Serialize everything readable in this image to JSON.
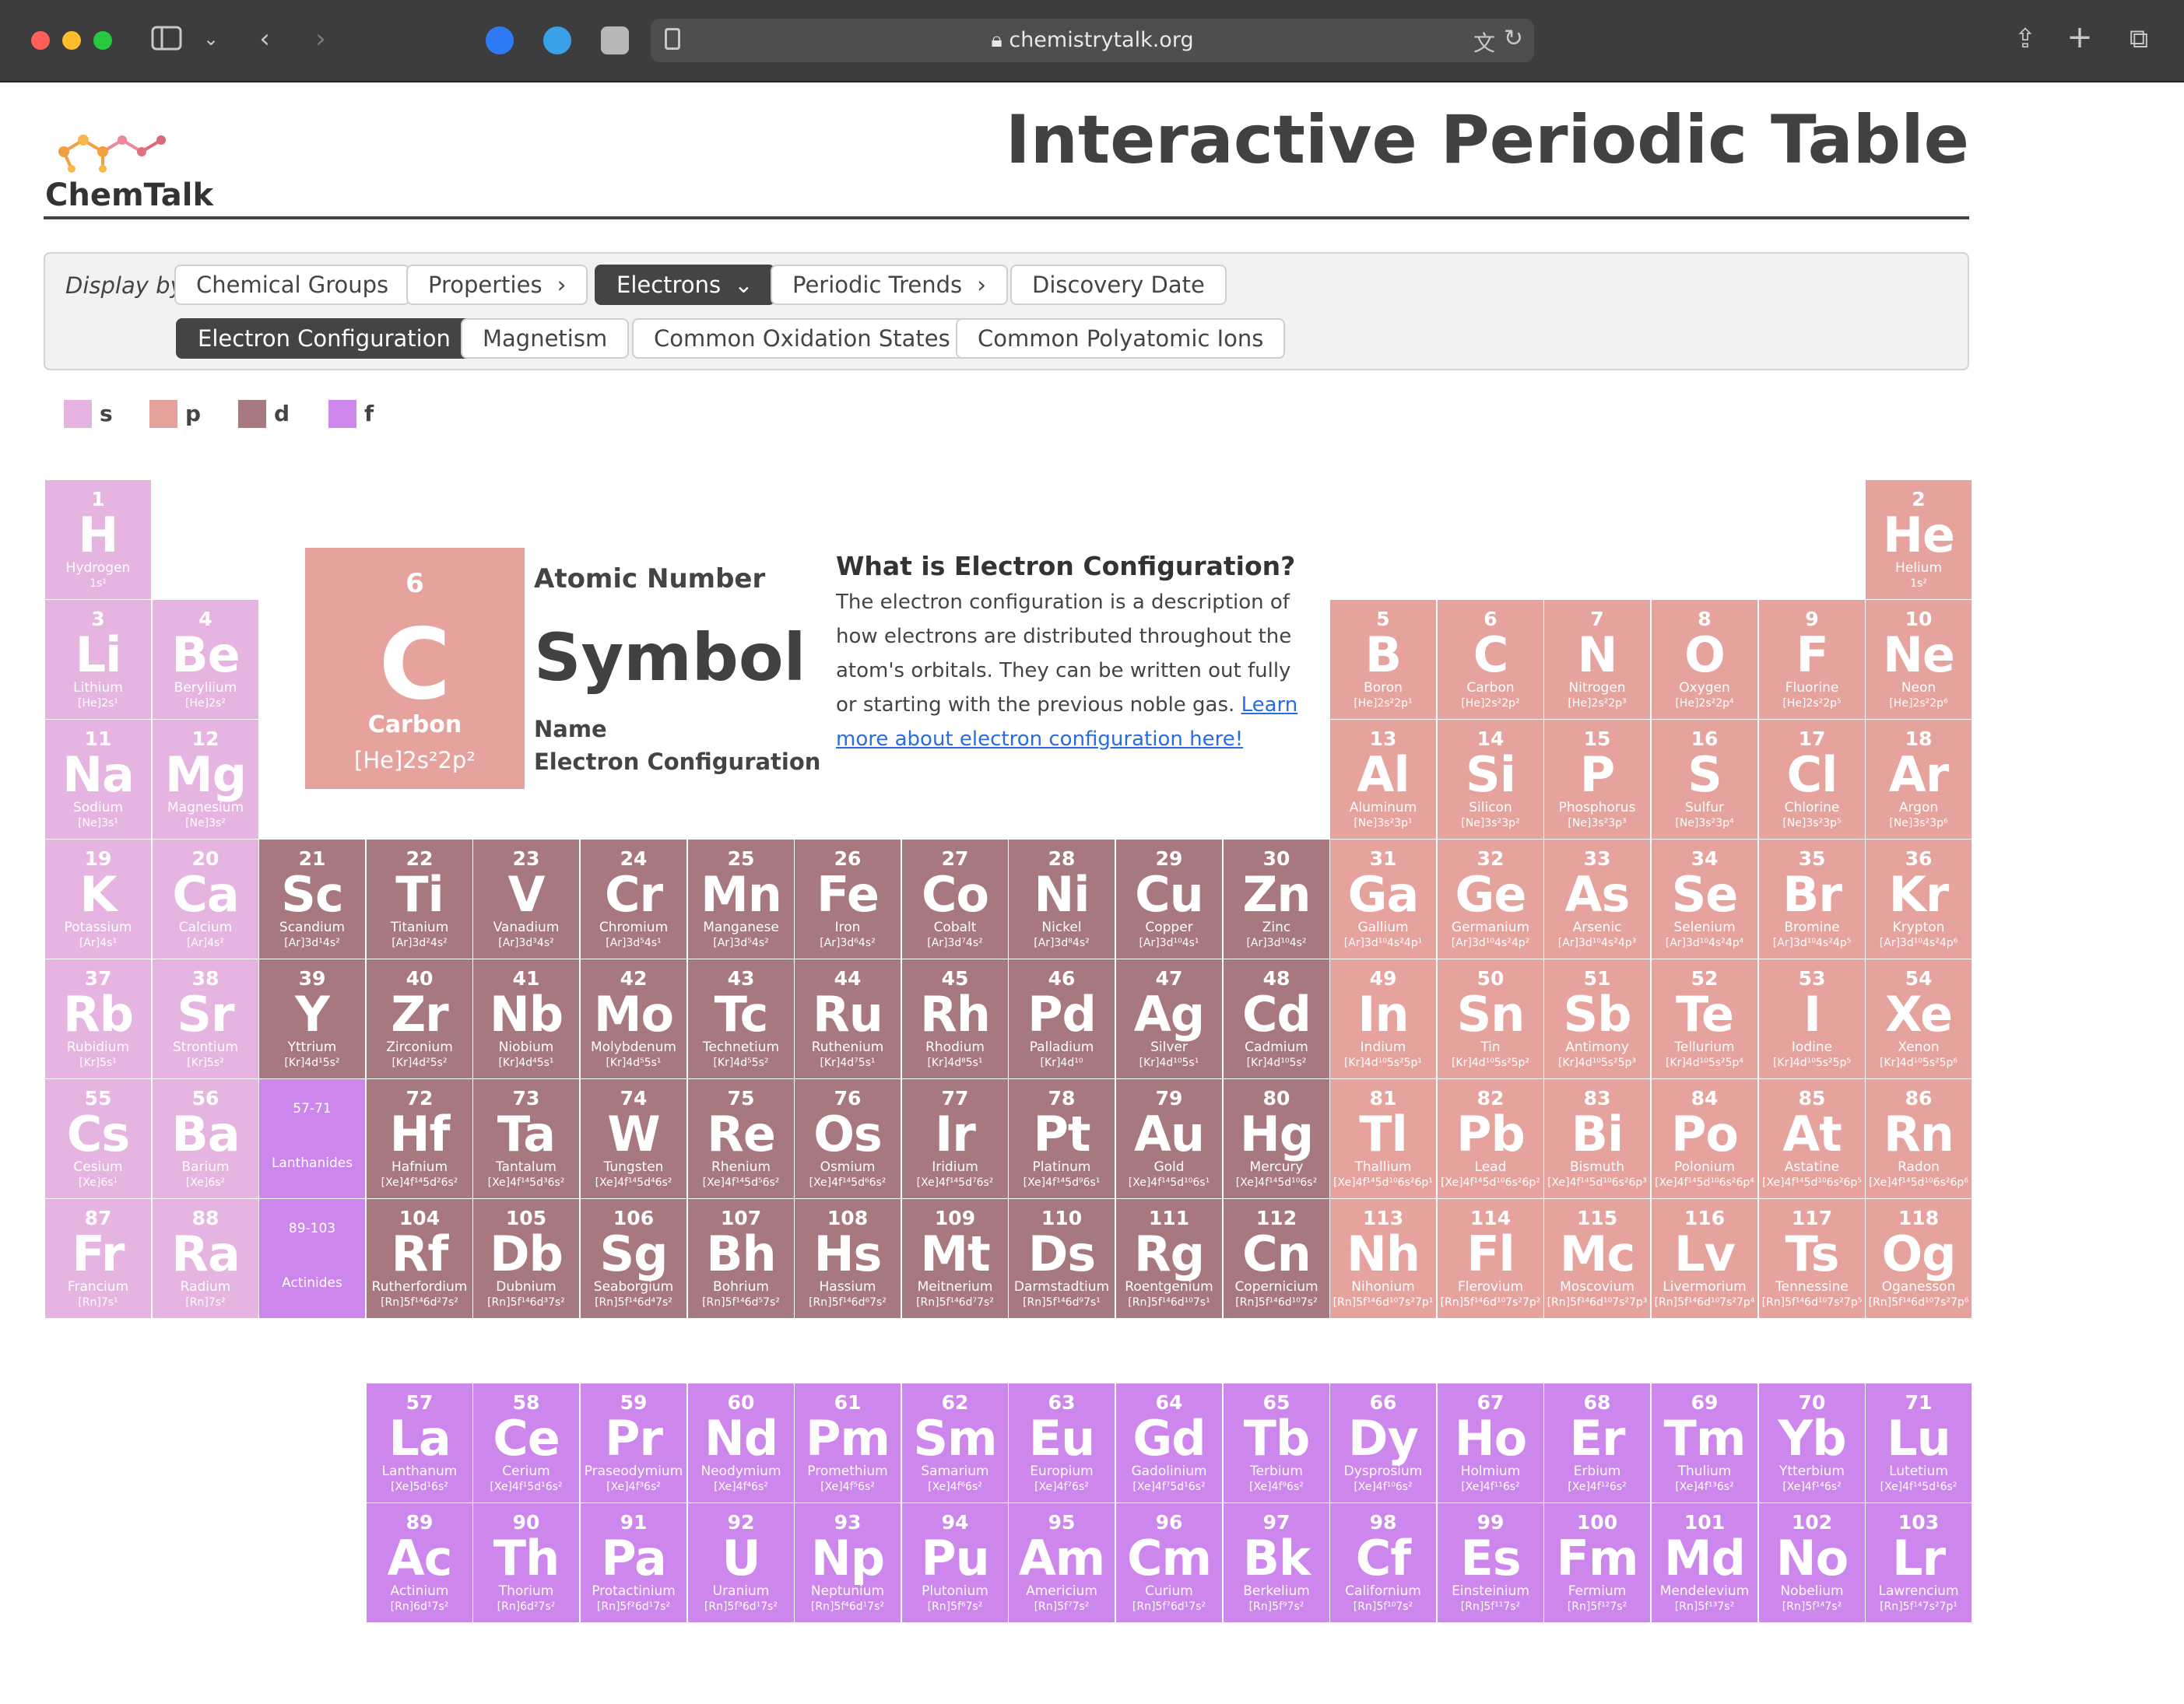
{
  "browser": {
    "url": "chemistrytalk.org"
  },
  "header": {
    "logo_text": "ChemTalk",
    "title": "Interactive Periodic Table"
  },
  "controls": {
    "display_by": "Display by",
    "row1": [
      {
        "label": "Chemical Groups",
        "suffix": ""
      },
      {
        "label": "Properties",
        "suffix": "›"
      },
      {
        "label": "Electrons",
        "suffix": "⌄",
        "active": true
      },
      {
        "label": "Periodic Trends",
        "suffix": "›"
      },
      {
        "label": "Discovery Date",
        "suffix": ""
      }
    ],
    "row2": [
      {
        "label": "Electron Configuration",
        "active": true
      },
      {
        "label": "Magnetism"
      },
      {
        "label": "Common Oxidation States"
      },
      {
        "label": "Common Polyatomic Ions"
      }
    ]
  },
  "legend": [
    {
      "label": "s",
      "color": "#e6b4e0"
    },
    {
      "label": "p",
      "color": "#e6a29d"
    },
    {
      "label": "d",
      "color": "#a8787f"
    },
    {
      "label": "f",
      "color": "#cc86ec"
    }
  ],
  "key": {
    "number": "6",
    "symbol": "C",
    "name": "Carbon",
    "config": "[He]2s²2p²",
    "labels": {
      "number": "Atomic Number",
      "symbol": "Symbol",
      "name": "Name",
      "config": "Electron Configuration"
    }
  },
  "info": {
    "heading": "What is Electron Configuration?",
    "body": "The electron configuration is a description of how electrons are distributed throughout the atom's orbitals. They can be written out fully or starting with the previous noble gas. ",
    "link": "Learn more about electron configuration here!"
  },
  "placeholders": [
    {
      "range": "57-71",
      "name": "Lanthanides"
    },
    {
      "range": "89-103",
      "name": "Actinides"
    }
  ],
  "elements": [
    [
      "1",
      "H",
      "Hydrogen",
      "1s¹",
      "s"
    ],
    [
      "2",
      "He",
      "Helium",
      "1s²",
      "p"
    ],
    [
      "3",
      "Li",
      "Lithium",
      "[He]2s¹",
      "s"
    ],
    [
      "4",
      "Be",
      "Beryllium",
      "[He]2s²",
      "s"
    ],
    [
      "5",
      "B",
      "Boron",
      "[He]2s²2p¹",
      "p"
    ],
    [
      "6",
      "C",
      "Carbon",
      "[He]2s²2p²",
      "p"
    ],
    [
      "7",
      "N",
      "Nitrogen",
      "[He]2s²2p³",
      "p"
    ],
    [
      "8",
      "O",
      "Oxygen",
      "[He]2s²2p⁴",
      "p"
    ],
    [
      "9",
      "F",
      "Fluorine",
      "[He]2s²2p⁵",
      "p"
    ],
    [
      "10",
      "Ne",
      "Neon",
      "[He]2s²2p⁶",
      "p"
    ],
    [
      "11",
      "Na",
      "Sodium",
      "[Ne]3s¹",
      "s"
    ],
    [
      "12",
      "Mg",
      "Magnesium",
      "[Ne]3s²",
      "s"
    ],
    [
      "13",
      "Al",
      "Aluminum",
      "[Ne]3s²3p¹",
      "p"
    ],
    [
      "14",
      "Si",
      "Silicon",
      "[Ne]3s²3p²",
      "p"
    ],
    [
      "15",
      "P",
      "Phosphorus",
      "[Ne]3s²3p³",
      "p"
    ],
    [
      "16",
      "S",
      "Sulfur",
      "[Ne]3s²3p⁴",
      "p"
    ],
    [
      "17",
      "Cl",
      "Chlorine",
      "[Ne]3s²3p⁵",
      "p"
    ],
    [
      "18",
      "Ar",
      "Argon",
      "[Ne]3s²3p⁶",
      "p"
    ],
    [
      "19",
      "K",
      "Potassium",
      "[Ar]4s¹",
      "s"
    ],
    [
      "20",
      "Ca",
      "Calcium",
      "[Ar]4s²",
      "s"
    ],
    [
      "21",
      "Sc",
      "Scandium",
      "[Ar]3d¹4s²",
      "d"
    ],
    [
      "22",
      "Ti",
      "Titanium",
      "[Ar]3d²4s²",
      "d"
    ],
    [
      "23",
      "V",
      "Vanadium",
      "[Ar]3d³4s²",
      "d"
    ],
    [
      "24",
      "Cr",
      "Chromium",
      "[Ar]3d⁵4s¹",
      "d"
    ],
    [
      "25",
      "Mn",
      "Manganese",
      "[Ar]3d⁵4s²",
      "d"
    ],
    [
      "26",
      "Fe",
      "Iron",
      "[Ar]3d⁶4s²",
      "d"
    ],
    [
      "27",
      "Co",
      "Cobalt",
      "[Ar]3d⁷4s²",
      "d"
    ],
    [
      "28",
      "Ni",
      "Nickel",
      "[Ar]3d⁸4s²",
      "d"
    ],
    [
      "29",
      "Cu",
      "Copper",
      "[Ar]3d¹⁰4s¹",
      "d"
    ],
    [
      "30",
      "Zn",
      "Zinc",
      "[Ar]3d¹⁰4s²",
      "d"
    ],
    [
      "31",
      "Ga",
      "Gallium",
      "[Ar]3d¹⁰4s²4p¹",
      "p"
    ],
    [
      "32",
      "Ge",
      "Germanium",
      "[Ar]3d¹⁰4s²4p²",
      "p"
    ],
    [
      "33",
      "As",
      "Arsenic",
      "[Ar]3d¹⁰4s²4p³",
      "p"
    ],
    [
      "34",
      "Se",
      "Selenium",
      "[Ar]3d¹⁰4s²4p⁴",
      "p"
    ],
    [
      "35",
      "Br",
      "Bromine",
      "[Ar]3d¹⁰4s²4p⁵",
      "p"
    ],
    [
      "36",
      "Kr",
      "Krypton",
      "[Ar]3d¹⁰4s²4p⁶",
      "p"
    ],
    [
      "37",
      "Rb",
      "Rubidium",
      "[Kr]5s¹",
      "s"
    ],
    [
      "38",
      "Sr",
      "Strontium",
      "[Kr]5s²",
      "s"
    ],
    [
      "39",
      "Y",
      "Yttrium",
      "[Kr]4d¹5s²",
      "d"
    ],
    [
      "40",
      "Zr",
      "Zirconium",
      "[Kr]4d²5s²",
      "d"
    ],
    [
      "41",
      "Nb",
      "Niobium",
      "[Kr]4d⁴5s¹",
      "d"
    ],
    [
      "42",
      "Mo",
      "Molybdenum",
      "[Kr]4d⁵5s¹",
      "d"
    ],
    [
      "43",
      "Tc",
      "Technetium",
      "[Kr]4d⁵5s²",
      "d"
    ],
    [
      "44",
      "Ru",
      "Ruthenium",
      "[Kr]4d⁷5s¹",
      "d"
    ],
    [
      "45",
      "Rh",
      "Rhodium",
      "[Kr]4d⁸5s¹",
      "d"
    ],
    [
      "46",
      "Pd",
      "Palladium",
      "[Kr]4d¹⁰",
      "d"
    ],
    [
      "47",
      "Ag",
      "Silver",
      "[Kr]4d¹⁰5s¹",
      "d"
    ],
    [
      "48",
      "Cd",
      "Cadmium",
      "[Kr]4d¹⁰5s²",
      "d"
    ],
    [
      "49",
      "In",
      "Indium",
      "[Kr]4d¹⁰5s²5p¹",
      "p"
    ],
    [
      "50",
      "Sn",
      "Tin",
      "[Kr]4d¹⁰5s²5p²",
      "p"
    ],
    [
      "51",
      "Sb",
      "Antimony",
      "[Kr]4d¹⁰5s²5p³",
      "p"
    ],
    [
      "52",
      "Te",
      "Tellurium",
      "[Kr]4d¹⁰5s²5p⁴",
      "p"
    ],
    [
      "53",
      "I",
      "Iodine",
      "[Kr]4d¹⁰5s²5p⁵",
      "p"
    ],
    [
      "54",
      "Xe",
      "Xenon",
      "[Kr]4d¹⁰5s²5p⁶",
      "p"
    ],
    [
      "55",
      "Cs",
      "Cesium",
      "[Xe]6s¹",
      "s"
    ],
    [
      "56",
      "Ba",
      "Barium",
      "[Xe]6s²",
      "s"
    ],
    [
      "72",
      "Hf",
      "Hafnium",
      "[Xe]4f¹⁴5d²6s²",
      "d"
    ],
    [
      "73",
      "Ta",
      "Tantalum",
      "[Xe]4f¹⁴5d³6s²",
      "d"
    ],
    [
      "74",
      "W",
      "Tungsten",
      "[Xe]4f¹⁴5d⁴6s²",
      "d"
    ],
    [
      "75",
      "Re",
      "Rhenium",
      "[Xe]4f¹⁴5d⁵6s²",
      "d"
    ],
    [
      "76",
      "Os",
      "Osmium",
      "[Xe]4f¹⁴5d⁶6s²",
      "d"
    ],
    [
      "77",
      "Ir",
      "Iridium",
      "[Xe]4f¹⁴5d⁷6s²",
      "d"
    ],
    [
      "78",
      "Pt",
      "Platinum",
      "[Xe]4f¹⁴5d⁹6s¹",
      "d"
    ],
    [
      "79",
      "Au",
      "Gold",
      "[Xe]4f¹⁴5d¹⁰6s¹",
      "d"
    ],
    [
      "80",
      "Hg",
      "Mercury",
      "[Xe]4f¹⁴5d¹⁰6s²",
      "d"
    ],
    [
      "81",
      "Tl",
      "Thallium",
      "[Xe]4f¹⁴5d¹⁰6s²6p¹",
      "p"
    ],
    [
      "82",
      "Pb",
      "Lead",
      "[Xe]4f¹⁴5d¹⁰6s²6p²",
      "p"
    ],
    [
      "83",
      "Bi",
      "Bismuth",
      "[Xe]4f¹⁴5d¹⁰6s²6p³",
      "p"
    ],
    [
      "84",
      "Po",
      "Polonium",
      "[Xe]4f¹⁴5d¹⁰6s²6p⁴",
      "p"
    ],
    [
      "85",
      "At",
      "Astatine",
      "[Xe]4f¹⁴5d¹⁰6s²6p⁵",
      "p"
    ],
    [
      "86",
      "Rn",
      "Radon",
      "[Xe]4f¹⁴5d¹⁰6s²6p⁶",
      "p"
    ],
    [
      "87",
      "Fr",
      "Francium",
      "[Rn]7s¹",
      "s"
    ],
    [
      "88",
      "Ra",
      "Radium",
      "[Rn]7s²",
      "s"
    ],
    [
      "104",
      "Rf",
      "Rutherfordium",
      "[Rn]5f¹⁴6d²7s²",
      "d"
    ],
    [
      "105",
      "Db",
      "Dubnium",
      "[Rn]5f¹⁴6d³7s²",
      "d"
    ],
    [
      "106",
      "Sg",
      "Seaborgium",
      "[Rn]5f¹⁴6d⁴7s²",
      "d"
    ],
    [
      "107",
      "Bh",
      "Bohrium",
      "[Rn]5f¹⁴6d⁵7s²",
      "d"
    ],
    [
      "108",
      "Hs",
      "Hassium",
      "[Rn]5f¹⁴6d⁶7s²",
      "d"
    ],
    [
      "109",
      "Mt",
      "Meitnerium",
      "[Rn]5f¹⁴6d⁷7s²",
      "d"
    ],
    [
      "110",
      "Ds",
      "Darmstadtium",
      "[Rn]5f¹⁴6d⁹7s¹",
      "d"
    ],
    [
      "111",
      "Rg",
      "Roentgenium",
      "[Rn]5f¹⁴6d¹⁰7s¹",
      "d"
    ],
    [
      "112",
      "Cn",
      "Copernicium",
      "[Rn]5f¹⁴6d¹⁰7s²",
      "d"
    ],
    [
      "113",
      "Nh",
      "Nihonium",
      "[Rn]5f¹⁴6d¹⁰7s²7p¹",
      "p"
    ],
    [
      "114",
      "Fl",
      "Flerovium",
      "[Rn]5f¹⁴6d¹⁰7s²7p²",
      "p"
    ],
    [
      "115",
      "Mc",
      "Moscovium",
      "[Rn]5f¹⁴6d¹⁰7s²7p³",
      "p"
    ],
    [
      "116",
      "Lv",
      "Livermorium",
      "[Rn]5f¹⁴6d¹⁰7s²7p⁴",
      "p"
    ],
    [
      "117",
      "Ts",
      "Tennessine",
      "[Rn]5f¹⁴6d¹⁰7s²7p⁵",
      "p"
    ],
    [
      "118",
      "Og",
      "Oganesson",
      "[Rn]5f¹⁴6d¹⁰7s²7p⁶",
      "p"
    ],
    [
      "57",
      "La",
      "Lanthanum",
      "[Xe]5d¹6s²",
      "f"
    ],
    [
      "58",
      "Ce",
      "Cerium",
      "[Xe]4f¹5d¹6s²",
      "f"
    ],
    [
      "59",
      "Pr",
      "Praseodymium",
      "[Xe]4f³6s²",
      "f"
    ],
    [
      "60",
      "Nd",
      "Neodymium",
      "[Xe]4f⁴6s²",
      "f"
    ],
    [
      "61",
      "Pm",
      "Promethium",
      "[Xe]4f⁵6s²",
      "f"
    ],
    [
      "62",
      "Sm",
      "Samarium",
      "[Xe]4f⁶6s²",
      "f"
    ],
    [
      "63",
      "Eu",
      "Europium",
      "[Xe]4f⁷6s²",
      "f"
    ],
    [
      "64",
      "Gd",
      "Gadolinium",
      "[Xe]4f⁷5d¹6s²",
      "f"
    ],
    [
      "65",
      "Tb",
      "Terbium",
      "[Xe]4f⁹6s²",
      "f"
    ],
    [
      "66",
      "Dy",
      "Dysprosium",
      "[Xe]4f¹⁰6s²",
      "f"
    ],
    [
      "67",
      "Ho",
      "Holmium",
      "[Xe]4f¹¹6s²",
      "f"
    ],
    [
      "68",
      "Er",
      "Erbium",
      "[Xe]4f¹²6s²",
      "f"
    ],
    [
      "69",
      "Tm",
      "Thulium",
      "[Xe]4f¹³6s²",
      "f"
    ],
    [
      "70",
      "Yb",
      "Ytterbium",
      "[Xe]4f¹⁴6s²",
      "f"
    ],
    [
      "71",
      "Lu",
      "Lutetium",
      "[Xe]4f¹⁴5d¹6s²",
      "f"
    ],
    [
      "89",
      "Ac",
      "Actinium",
      "[Rn]6d¹7s²",
      "f"
    ],
    [
      "90",
      "Th",
      "Thorium",
      "[Rn]6d²7s²",
      "f"
    ],
    [
      "91",
      "Pa",
      "Protactinium",
      "[Rn]5f²6d¹7s²",
      "f"
    ],
    [
      "92",
      "U",
      "Uranium",
      "[Rn]5f³6d¹7s²",
      "f"
    ],
    [
      "93",
      "Np",
      "Neptunium",
      "[Rn]5f⁴6d¹7s²",
      "f"
    ],
    [
      "94",
      "Pu",
      "Plutonium",
      "[Rn]5f⁶7s²",
      "f"
    ],
    [
      "95",
      "Am",
      "Americium",
      "[Rn]5f⁷7s²",
      "f"
    ],
    [
      "96",
      "Cm",
      "Curium",
      "[Rn]5f⁷6d¹7s²",
      "f"
    ],
    [
      "97",
      "Bk",
      "Berkelium",
      "[Rn]5f⁹7s²",
      "f"
    ],
    [
      "98",
      "Cf",
      "Californium",
      "[Rn]5f¹⁰7s²",
      "f"
    ],
    [
      "99",
      "Es",
      "Einsteinium",
      "[Rn]5f¹¹7s²",
      "f"
    ],
    [
      "100",
      "Fm",
      "Fermium",
      "[Rn]5f¹²7s²",
      "f"
    ],
    [
      "101",
      "Md",
      "Mendelevium",
      "[Rn]5f¹³7s²",
      "f"
    ],
    [
      "102",
      "No",
      "Nobelium",
      "[Rn]5f¹⁴7s²",
      "f"
    ],
    [
      "103",
      "Lr",
      "Lawrencium",
      "[Rn]5f¹⁴7s²7p¹",
      "f"
    ]
  ]
}
